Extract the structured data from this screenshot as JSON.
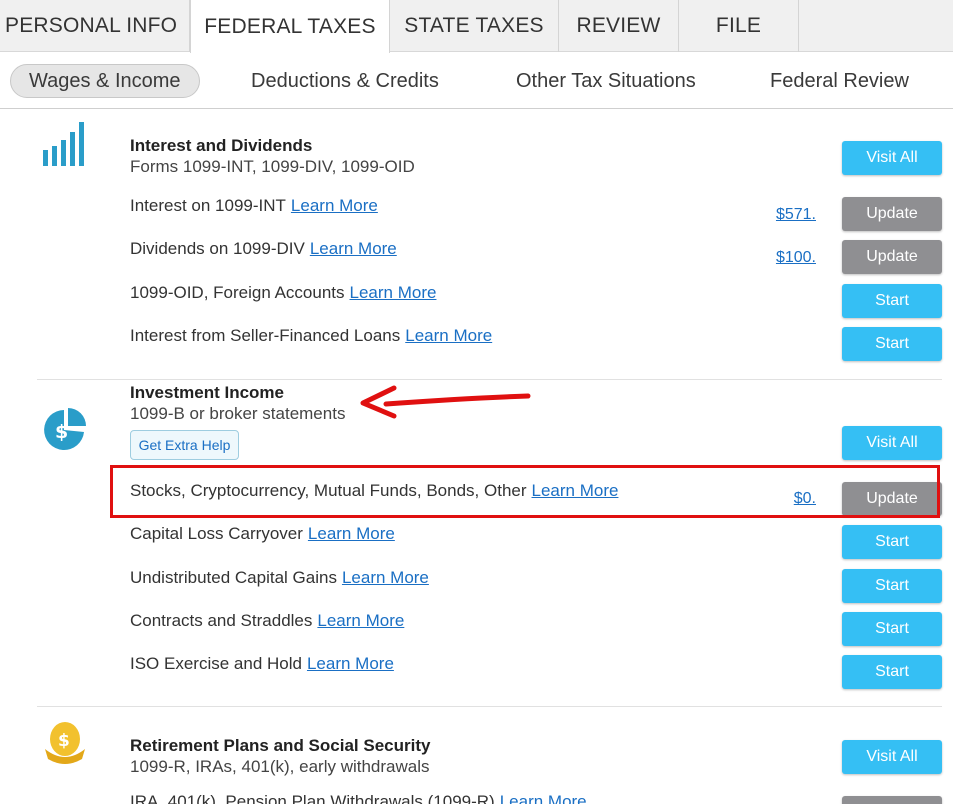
{
  "top_tabs": [
    "PERSONAL INFO",
    "FEDERAL TAXES",
    "STATE TAXES",
    "REVIEW",
    "FILE"
  ],
  "sub_tabs": [
    "Wages & Income",
    "Deductions & Credits",
    "Other Tax Situations",
    "Federal Review"
  ],
  "learn_more": "Learn More",
  "colors": {
    "accent_blue": "#35bff4",
    "update_grey": "#8f8f92",
    "link_blue": "#1a6fc4",
    "annotation_red": "#e01010"
  },
  "sections": {
    "interest": {
      "icon": "bar-chart-icon",
      "title": "Interest and Dividends",
      "subtitle": "Forms 1099-INT, 1099-DIV, 1099-OID",
      "visit_all": "Visit All",
      "rows": [
        {
          "label": "Interest on 1099-INT",
          "amount": "$571.",
          "action": "Update"
        },
        {
          "label": "Dividends on 1099-DIV",
          "amount": "$100.",
          "action": "Update"
        },
        {
          "label": "1099-OID, Foreign Accounts",
          "amount": "",
          "action": "Start"
        },
        {
          "label": "Interest from Seller-Financed Loans",
          "amount": "",
          "action": "Start"
        }
      ]
    },
    "investment": {
      "icon": "pie-chart-dollar-icon",
      "title": "Investment Income",
      "subtitle": "1099-B or broker statements",
      "extra_help": "Get Extra Help",
      "visit_all": "Visit All",
      "rows": [
        {
          "label": "Stocks, Cryptocurrency, Mutual Funds, Bonds, Other",
          "amount": "$0.",
          "action": "Update"
        },
        {
          "label": "Capital Loss Carryover",
          "amount": "",
          "action": "Start"
        },
        {
          "label": "Undistributed Capital Gains",
          "amount": "",
          "action": "Start"
        },
        {
          "label": "Contracts and Straddles",
          "amount": "",
          "action": "Start"
        },
        {
          "label": "ISO Exercise and Hold",
          "amount": "",
          "action": "Start"
        }
      ]
    },
    "retirement": {
      "icon": "nest-egg-dollar-icon",
      "title": "Retirement Plans and Social Security",
      "subtitle": "1099-R, IRAs, 401(k), early withdrawals",
      "visit_all": "Visit All",
      "rows": [
        {
          "label": "IRA, 401(k), Pension Plan Withdrawals (1099-R)",
          "amount": "",
          "action": ""
        }
      ]
    }
  }
}
